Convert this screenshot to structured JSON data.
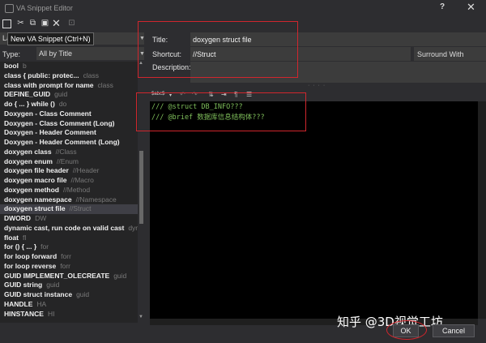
{
  "window": {
    "title": "VA Snippet Editor",
    "help_label": "?",
    "close_label": "✕"
  },
  "toolbar": {
    "tooltip": "New VA Snippet (Ctrl+N)",
    "language_prefix": "La"
  },
  "type_filter": {
    "label": "Type:",
    "value": "All by Title"
  },
  "snippets": [
    {
      "name": "bool",
      "shortcut": "b"
    },
    {
      "name": "class { public: protec...",
      "shortcut": "class"
    },
    {
      "name": "class with prompt for name",
      "shortcut": "class"
    },
    {
      "name": "DEFINE_GUID",
      "shortcut": "guid"
    },
    {
      "name": "do { ... } while ()",
      "shortcut": "do"
    },
    {
      "name": "Doxygen - Class Comment",
      "shortcut": ""
    },
    {
      "name": "Doxygen - Class Comment (Long)",
      "shortcut": ""
    },
    {
      "name": "Doxygen - Header Comment",
      "shortcut": ""
    },
    {
      "name": "Doxygen - Header Comment (Long)",
      "shortcut": ""
    },
    {
      "name": "doxygen class",
      "shortcut": "//Class"
    },
    {
      "name": "doxygen enum",
      "shortcut": "//Enum"
    },
    {
      "name": "doxygen file header",
      "shortcut": "//Header"
    },
    {
      "name": "doxygen macro file",
      "shortcut": "//Macro"
    },
    {
      "name": "doxygen method",
      "shortcut": "//Method"
    },
    {
      "name": "doxygen namespace",
      "shortcut": "//Namespace"
    },
    {
      "name": "doxygen struct file",
      "shortcut": "//Struct"
    },
    {
      "name": "DWORD",
      "shortcut": "DW"
    },
    {
      "name": "dynamic cast, run code on valid cast",
      "shortcut": "dyn"
    },
    {
      "name": "float",
      "shortcut": "fl"
    },
    {
      "name": "for () { ... }",
      "shortcut": "for"
    },
    {
      "name": "for loop forward",
      "shortcut": "forr"
    },
    {
      "name": "for loop reverse",
      "shortcut": "forr"
    },
    {
      "name": "GUID IMPLEMENT_OLECREATE",
      "shortcut": "guid"
    },
    {
      "name": "GUID string",
      "shortcut": "guid"
    },
    {
      "name": "GUID struct instance",
      "shortcut": "guid"
    },
    {
      "name": "HANDLE",
      "shortcut": "HA"
    },
    {
      "name": "HINSTANCE",
      "shortcut": "HI"
    }
  ],
  "selected_index": 15,
  "form": {
    "title_label": "Title:",
    "title_value": "doxygen struct file",
    "shortcut_label": "Shortcut:",
    "shortcut_value": "//Struct",
    "surround_label": "Surround With",
    "description_label": "Description:"
  },
  "editor": {
    "toolbar_first": "$abc$",
    "lines": [
      "/// @struct DB_INFO???",
      "/// @brief 数据库信息结构体???"
    ]
  },
  "watermark": "知乎 @3D视觉工坊",
  "buttons": {
    "ok": "OK",
    "cancel": "Cancel"
  },
  "colors": {
    "annotation_red": "#d0262d",
    "code_green": "#7fbf5b",
    "editor_bg": "#000000"
  }
}
